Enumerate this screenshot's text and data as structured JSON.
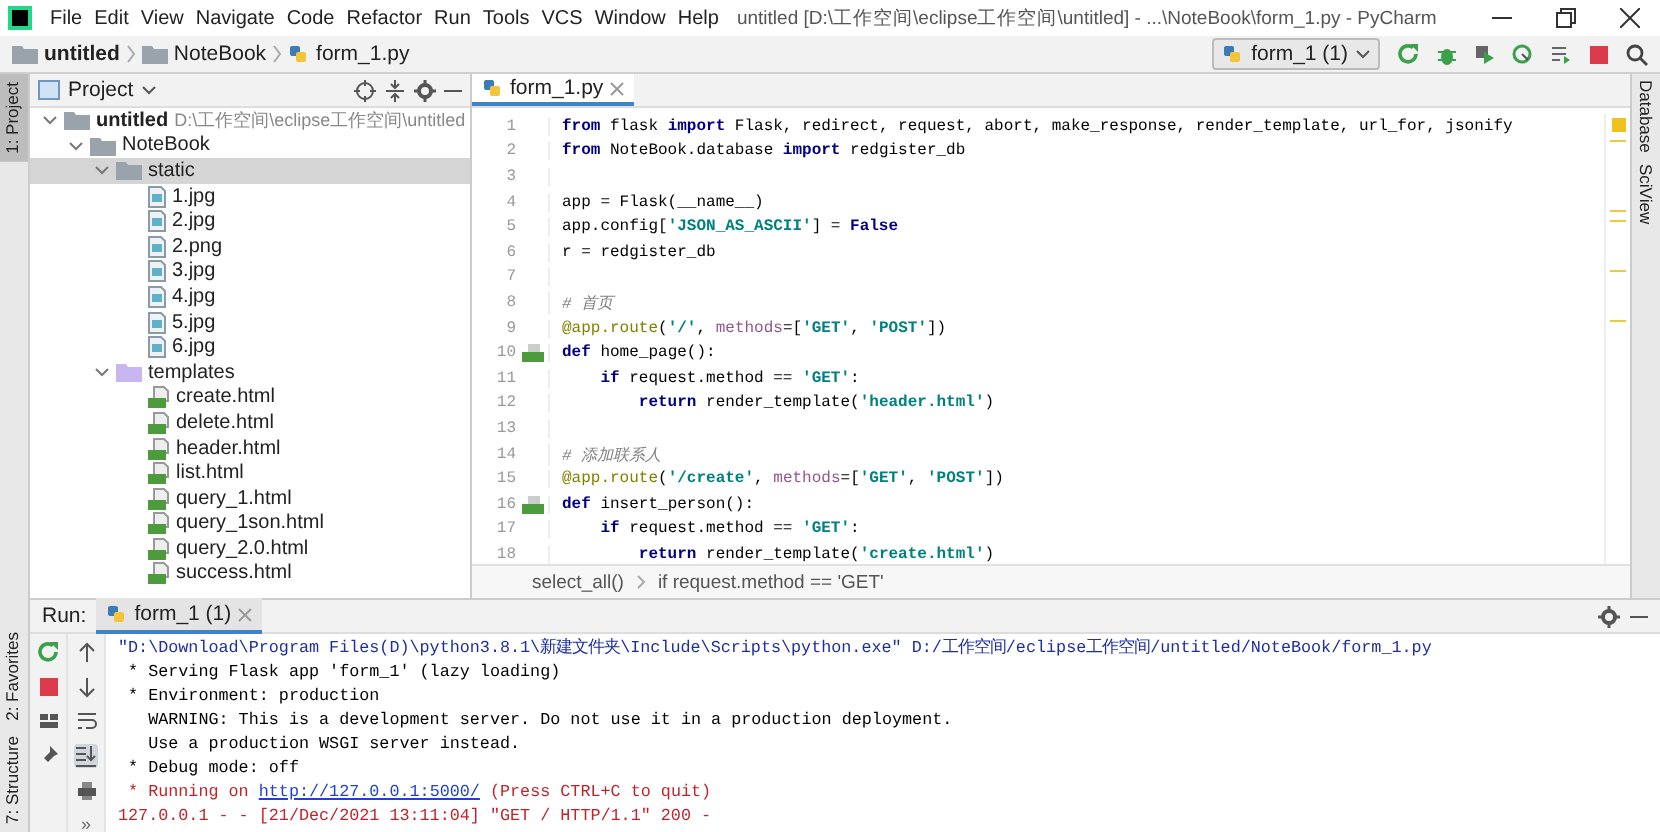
{
  "window": {
    "title": "untitled [D:\\工作空间\\eclipse工作空间\\untitled] - ...\\NoteBook\\form_1.py - PyCharm"
  },
  "menu": [
    "File",
    "Edit",
    "View",
    "Navigate",
    "Code",
    "Refactor",
    "Run",
    "Tools",
    "VCS",
    "Window",
    "Help"
  ],
  "navigation": {
    "crumbs": [
      {
        "label": "untitled",
        "kind": "folder"
      },
      {
        "label": "NoteBook",
        "kind": "folder"
      },
      {
        "label": "form_1.py",
        "kind": "python"
      }
    ],
    "run_config": "form_1 (1)"
  },
  "left_tool_tabs": [
    {
      "label": "1: Project",
      "selected": true
    },
    {
      "label": "2: Favorites",
      "selected": false
    },
    {
      "label": "7: Structure",
      "selected": false
    }
  ],
  "right_tool_tabs": [
    {
      "label": "Database"
    },
    {
      "label": "SciView"
    }
  ],
  "project": {
    "title": "Project",
    "tree": [
      {
        "label": "untitled",
        "path": "D:\\工作空间\\eclipse工作空间\\untitled",
        "kind": "folder",
        "expanded": true,
        "selected": false,
        "children": [
          {
            "label": "NoteBook",
            "kind": "folder",
            "expanded": true,
            "selected": false,
            "children": [
              {
                "label": "static",
                "kind": "folder",
                "expanded": true,
                "selected": true,
                "children": [
                  {
                    "label": "1.jpg",
                    "kind": "image",
                    "selected": false
                  },
                  {
                    "label": "2.jpg",
                    "kind": "image",
                    "selected": false
                  },
                  {
                    "label": "2.png",
                    "kind": "image",
                    "selected": false
                  },
                  {
                    "label": "3.jpg",
                    "kind": "image",
                    "selected": false
                  },
                  {
                    "label": "4.jpg",
                    "kind": "image",
                    "selected": false
                  },
                  {
                    "label": "5.jpg",
                    "kind": "image",
                    "selected": false
                  },
                  {
                    "label": "6.jpg",
                    "kind": "image",
                    "selected": false
                  }
                ]
              },
              {
                "label": "templates",
                "kind": "template-folder",
                "expanded": true,
                "selected": false,
                "children": [
                  {
                    "label": "create.html",
                    "kind": "html",
                    "selected": false
                  },
                  {
                    "label": "delete.html",
                    "kind": "html",
                    "selected": false
                  },
                  {
                    "label": "header.html",
                    "kind": "html",
                    "selected": false
                  },
                  {
                    "label": "list.html",
                    "kind": "html",
                    "selected": false
                  },
                  {
                    "label": "query_1.html",
                    "kind": "html",
                    "selected": false
                  },
                  {
                    "label": "query_1son.html",
                    "kind": "html",
                    "selected": false
                  },
                  {
                    "label": "query_2.0.html",
                    "kind": "html",
                    "selected": false
                  },
                  {
                    "label": "success.html",
                    "kind": "html",
                    "selected": false
                  }
                ]
              }
            ]
          }
        ]
      }
    ]
  },
  "editor": {
    "tab": "form_1.py",
    "lines": [
      {
        "number": "1",
        "run_marker": false,
        "tokens": [
          {
            "kind": "kw",
            "text": "from"
          },
          {
            "kind": "plain",
            "text": " flask "
          },
          {
            "kind": "kw",
            "text": "import"
          },
          {
            "kind": "plain",
            "text": " Flask, redirect, request, abort, make_response, render_template, url_for, jsonify"
          }
        ]
      },
      {
        "number": "2",
        "run_marker": false,
        "tokens": [
          {
            "kind": "kw",
            "text": "from"
          },
          {
            "kind": "plain",
            "text": " NoteBook.database "
          },
          {
            "kind": "kw",
            "text": "import"
          },
          {
            "kind": "plain",
            "text": " redgister_db"
          }
        ]
      },
      {
        "number": "3",
        "run_marker": false
      },
      {
        "number": "4",
        "run_marker": false,
        "tokens": [
          {
            "kind": "plain",
            "text": "app = Flask(__name__)"
          }
        ]
      },
      {
        "number": "5",
        "run_marker": false,
        "tokens": [
          {
            "kind": "plain",
            "text": "app.config["
          },
          {
            "kind": "str",
            "text": "'JSON_AS_ASCII'"
          },
          {
            "kind": "plain",
            "text": "] = "
          },
          {
            "kind": "kw",
            "text": "False"
          }
        ]
      },
      {
        "number": "6",
        "run_marker": false,
        "tokens": [
          {
            "kind": "plain",
            "text": "r = redgister_db"
          }
        ]
      },
      {
        "number": "7",
        "run_marker": false
      },
      {
        "number": "8",
        "run_marker": false,
        "tokens": [
          {
            "kind": "comment",
            "text": "# 首页"
          }
        ]
      },
      {
        "number": "9",
        "run_marker": false,
        "tokens": [
          {
            "kind": "deco",
            "text": "@app.route"
          },
          {
            "kind": "plain",
            "text": "("
          },
          {
            "kind": "str",
            "text": "'/'"
          },
          {
            "kind": "plain",
            "text": ", "
          },
          {
            "kind": "param",
            "text": "methods"
          },
          {
            "kind": "plain",
            "text": "=["
          },
          {
            "kind": "str",
            "text": "'GET'"
          },
          {
            "kind": "plain",
            "text": ", "
          },
          {
            "kind": "str",
            "text": "'POST'"
          },
          {
            "kind": "plain",
            "text": "])"
          }
        ]
      },
      {
        "number": "10",
        "run_marker": true,
        "tokens": [
          {
            "kind": "kw",
            "text": "def"
          },
          {
            "kind": "plain",
            "text": " home_page():"
          }
        ]
      },
      {
        "number": "11",
        "run_marker": false,
        "tokens": [
          {
            "kind": "kw",
            "text": "    if"
          },
          {
            "kind": "plain",
            "text": " request.method == "
          },
          {
            "kind": "str",
            "text": "'GET'"
          },
          {
            "kind": "plain",
            "text": ":"
          }
        ]
      },
      {
        "number": "12",
        "run_marker": false,
        "tokens": [
          {
            "kind": "kw",
            "text": "        return"
          },
          {
            "kind": "plain",
            "text": " render_template("
          },
          {
            "kind": "str",
            "text": "'header.html'"
          },
          {
            "kind": "plain",
            "text": ")"
          }
        ]
      },
      {
        "number": "13",
        "run_marker": false
      },
      {
        "number": "14",
        "run_marker": false,
        "tokens": [
          {
            "kind": "comment",
            "text": "# 添加联系人"
          }
        ]
      },
      {
        "number": "15",
        "run_marker": false,
        "tokens": [
          {
            "kind": "deco",
            "text": "@app.route"
          },
          {
            "kind": "plain",
            "text": "("
          },
          {
            "kind": "str",
            "text": "'/create'"
          },
          {
            "kind": "plain",
            "text": ", "
          },
          {
            "kind": "param",
            "text": "methods"
          },
          {
            "kind": "plain",
            "text": "=["
          },
          {
            "kind": "str",
            "text": "'GET'"
          },
          {
            "kind": "plain",
            "text": ", "
          },
          {
            "kind": "str",
            "text": "'POST'"
          },
          {
            "kind": "plain",
            "text": "])"
          }
        ]
      },
      {
        "number": "16",
        "run_marker": true,
        "tokens": [
          {
            "kind": "kw",
            "text": "def"
          },
          {
            "kind": "plain",
            "text": " insert_person():"
          }
        ]
      },
      {
        "number": "17",
        "run_marker": false,
        "tokens": [
          {
            "kind": "kw",
            "text": "    if"
          },
          {
            "kind": "plain",
            "text": " request.method == "
          },
          {
            "kind": "str",
            "text": "'GET'"
          },
          {
            "kind": "plain",
            "text": ":"
          }
        ]
      },
      {
        "number": "18",
        "run_marker": false,
        "tokens": [
          {
            "kind": "kw",
            "text": "        return"
          },
          {
            "kind": "plain",
            "text": " render_template("
          },
          {
            "kind": "str",
            "text": "'create.html'"
          },
          {
            "kind": "plain",
            "text": ")"
          }
        ]
      }
    ],
    "breadcrumbs": [
      "select_all()",
      "if request.method == 'GET'"
    ]
  },
  "run": {
    "label": "Run:",
    "tab": "form_1 (1)",
    "scroll_to_end_on": true,
    "more": "»",
    "console": [
      [
        {
          "kind": "command",
          "text": "\"D:\\Download\\Program Files(D)\\python3.8.1\\新建文件夹\\Include\\Scripts\\python.exe\" D:/工作空间/eclipse工作空间/untitled/NoteBook/form_1.py"
        }
      ],
      [
        {
          "kind": "plain",
          "text": " * Serving Flask app 'form_1' (lazy loading)"
        }
      ],
      [
        {
          "kind": "plain",
          "text": " * Environment: production"
        }
      ],
      [
        {
          "kind": "plain",
          "text": "   WARNING: This is a development server. Do not use it in a production deployment."
        }
      ],
      [
        {
          "kind": "plain",
          "text": "   Use a production WSGI server instead."
        }
      ],
      [
        {
          "kind": "plain",
          "text": " * Debug mode: off"
        }
      ],
      [
        {
          "kind": "error",
          "text": " * Running on "
        },
        {
          "kind": "link",
          "text": "http://127.0.0.1:5000/"
        },
        {
          "kind": "error",
          "text": " (Press CTRL+C to quit)"
        }
      ],
      [
        {
          "kind": "error",
          "text": "127.0.0.1 - - [21/Dec/2021 13:11:04] \"GET / HTTP/1.1\" 200 -"
        }
      ]
    ]
  }
}
